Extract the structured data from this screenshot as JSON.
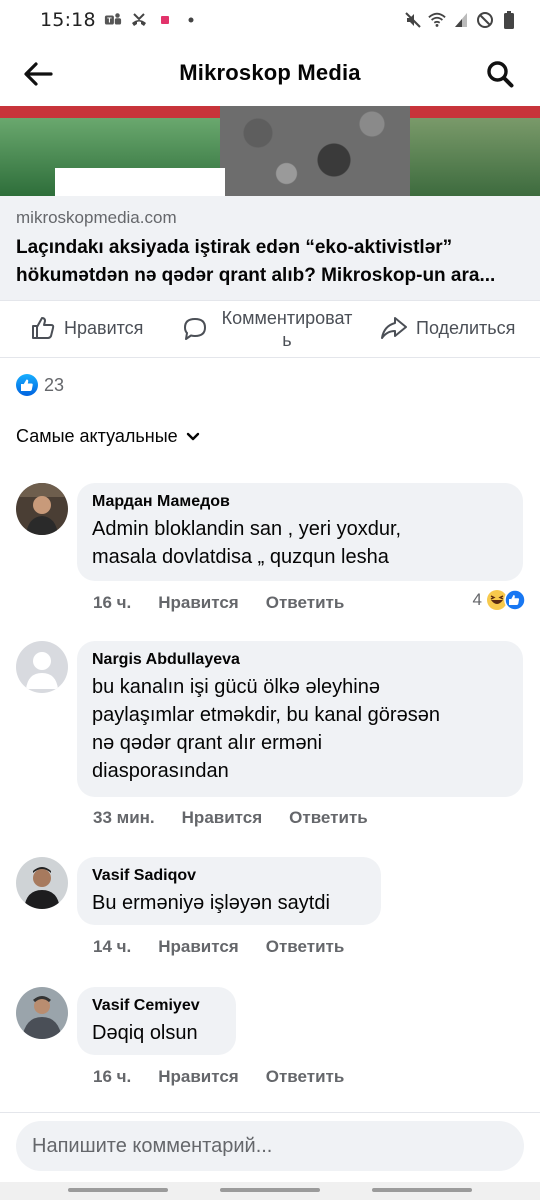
{
  "status_bar": {
    "time": "15:18",
    "icons_left": [
      "teams-icon",
      "missed-call-icon",
      "notification-dot-icon",
      "dot-icon"
    ],
    "icons_right": [
      "mute-icon",
      "wifi-icon",
      "signal-icon",
      "no-disturb-icon",
      "battery-icon"
    ]
  },
  "header": {
    "title": "Mikroskop Media",
    "back_icon": "arrow-left-icon",
    "search_icon": "search-icon"
  },
  "link_preview": {
    "domain": "mikroskopmedia.com",
    "title_line1": "Laçındakı aksiyada iştirak edən “eko-aktivistlər”",
    "title_line2": "hökumətdən nə qədər qrant alıb? Mikroskop-un ara..."
  },
  "actions": {
    "like": "Нравится",
    "comment": "Комментироват ь",
    "share": "Поделиться"
  },
  "reactions": {
    "count": "23"
  },
  "sort": {
    "label": "Самые актуальные"
  },
  "comments": [
    {
      "name": "Мардан Мамедов",
      "text_lines": [
        "Admin bloklandin san , yeri yoxdur,",
        "masala dovlatdisa „ quzqun lesha"
      ],
      "time": "16 ч.",
      "like": "Нравится",
      "reply": "Ответить",
      "reaction_count": "4"
    },
    {
      "name": "Nargis Abdullayeva",
      "text_lines": [
        "bu kanalın işi gücü ölkə əleyhinə",
        "paylaşımlar etməkdir, bu kanal görəsən",
        "nə qədər qrant alır erməni",
        "diasporasından"
      ],
      "time": "33 мин.",
      "like": "Нравится",
      "reply": "Ответить"
    },
    {
      "name": "Vasif Sadiqov",
      "text_lines": [
        "Bu erməniyə işləyən saytdi"
      ],
      "time": "14 ч.",
      "like": "Нравится",
      "reply": "Ответить"
    },
    {
      "name": "Vasif Cemiyev",
      "text_lines": [
        "Dəqiq olsun"
      ],
      "time": "16 ч.",
      "like": "Нравится",
      "reply": "Ответить"
    }
  ],
  "composer": {
    "placeholder": "Напишите комментарий..."
  },
  "colors": {
    "bubble": "#f0f2f5",
    "meta_text": "#65676b",
    "like_blue": "#0866ff"
  }
}
